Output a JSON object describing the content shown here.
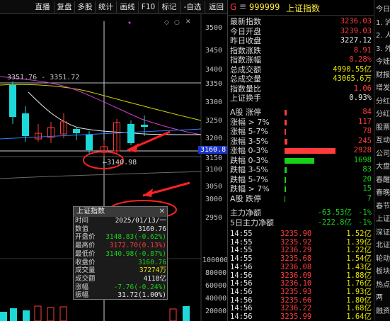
{
  "toolbar": {
    "buttons": [
      "直播",
      "复盘",
      "多股",
      "统计",
      "画线",
      "F10",
      "标记",
      "-自选",
      "返回"
    ]
  },
  "chart": {
    "price_ticks": [
      "3500",
      "3450",
      "3400",
      "3350",
      "3300",
      "3250",
      "3200",
      "3150",
      "3100",
      "3050",
      "3000",
      "2950"
    ],
    "volume_ticks": [
      "100000",
      "80000",
      "60000",
      "40000",
      "20000"
    ],
    "crosshair_price": "3160.8",
    "range_label": "3351.76 - 3351.72",
    "low_label": "←3140.98"
  },
  "popup": {
    "title": "上证指数",
    "rows": [
      {
        "k": "时间",
        "v": "2025/01/13/一",
        "c": "wht"
      },
      {
        "k": "数值",
        "v": "3160.76",
        "c": "wht"
      },
      {
        "k": "开盘价",
        "v": "3148.83(-0.62%)",
        "c": "grn"
      },
      {
        "k": "最高价",
        "v": "3172.70(0.13%)",
        "c": "red"
      },
      {
        "k": "最低价",
        "v": "3140.98(-0.87%)",
        "c": "grn"
      },
      {
        "k": "收盘价",
        "v": "3160.76",
        "c": "grn"
      },
      {
        "k": "成交量",
        "v": "37274万",
        "c": "yel"
      },
      {
        "k": "成交额",
        "v": "4118亿",
        "c": "wht"
      },
      {
        "k": "涨幅",
        "v": "-7.76(-0.24%)",
        "c": "grn"
      },
      {
        "k": "振幅",
        "v": "31.72(1.00%)",
        "c": "wht"
      }
    ]
  },
  "quote": {
    "code": "999999",
    "name": "上证指数",
    "g": "G",
    "rows": [
      {
        "k": "最新指数",
        "v": "3236.03",
        "c": "red"
      },
      {
        "k": "今日开盘",
        "v": "3239.03",
        "c": "red"
      },
      {
        "k": "昨日收盘",
        "v": "3227.12",
        "c": "wht"
      },
      {
        "k": "指数涨跌",
        "v": "8.91",
        "c": "red"
      },
      {
        "k": "指数涨幅",
        "v": "0.28%",
        "c": "red"
      },
      {
        "k": "总成交额",
        "v": "4990.55亿",
        "c": "yel"
      },
      {
        "k": "总成交量",
        "v": "43065.6万",
        "c": "yel"
      },
      {
        "k": "指数量比",
        "v": "1.06",
        "c": "red"
      },
      {
        "k": "上证换手",
        "v": "0.93%",
        "c": "wht"
      }
    ],
    "breadth": [
      {
        "k": "A股 涨停",
        "v": "84",
        "c": "red",
        "w": 3
      },
      {
        "k": "涨幅 > 7%",
        "v": "117",
        "c": "red",
        "w": 3
      },
      {
        "k": "涨幅 5-7%",
        "v": "78",
        "c": "red",
        "w": 2
      },
      {
        "k": "涨幅 3-5%",
        "v": "245",
        "c": "red",
        "w": 4
      },
      {
        "k": "涨幅 0-3%",
        "v": "2928",
        "c": "red",
        "w": 72
      },
      {
        "k": "跌幅 0-3%",
        "v": "1698",
        "c": "grn",
        "w": 42
      },
      {
        "k": "跌幅 3-5%",
        "v": "83",
        "c": "grn",
        "w": 3
      },
      {
        "k": "跌幅 5-7%",
        "v": "20",
        "c": "grn",
        "w": 2
      },
      {
        "k": "跌幅 > 7%",
        "v": "15",
        "c": "grn",
        "w": 2
      },
      {
        "k": "A股 跌停",
        "v": "7",
        "c": "grn",
        "w": 1
      }
    ],
    "flows": [
      {
        "k": "主力净额",
        "v": "-63.53亿",
        "p": "-1%"
      },
      {
        "k": "5日主力净额",
        "v": "-222.8亿",
        "p": "-1%"
      }
    ],
    "ticks": [
      {
        "t": "14:55",
        "p": "3235.90",
        "v": "1.52亿"
      },
      {
        "t": "14:55",
        "p": "3235.92",
        "v": "1.39亿"
      },
      {
        "t": "14:55",
        "p": "3236.29",
        "v": "1.22亿"
      },
      {
        "t": "14:55",
        "p": "3235.68",
        "v": "1.54亿"
      },
      {
        "t": "14:56",
        "p": "3236.08",
        "v": "1.43亿"
      },
      {
        "t": "14:56",
        "p": "3236.09",
        "v": "1.88亿"
      },
      {
        "t": "14:56",
        "p": "3236.10",
        "v": "1.76亿"
      },
      {
        "t": "14:56",
        "p": "3235.93",
        "v": "1.93亿"
      },
      {
        "t": "14:56",
        "p": "3235.66",
        "v": "1.80亿"
      },
      {
        "t": "14:56",
        "p": "3236.22",
        "v": "1.68亿"
      },
      {
        "t": "14:56",
        "p": "3235.99",
        "v": "1.64亿"
      }
    ]
  },
  "far": {
    "items": [
      "今日",
      "1. 沪",
      "2. 人",
      "3. 外",
      "今娃",
      "财报",
      "增发",
      "分红",
      "分红",
      "股票",
      "互动",
      "公司",
      "大盘",
      "春醒",
      "春晚",
      "春节",
      "上证",
      "深证",
      "北证",
      "轮动",
      "板块",
      "热点",
      "两",
      "融资"
    ]
  },
  "colors": {
    "up": "#ff3b3b",
    "down": "#1ad11a",
    "bg": "#000000"
  }
}
